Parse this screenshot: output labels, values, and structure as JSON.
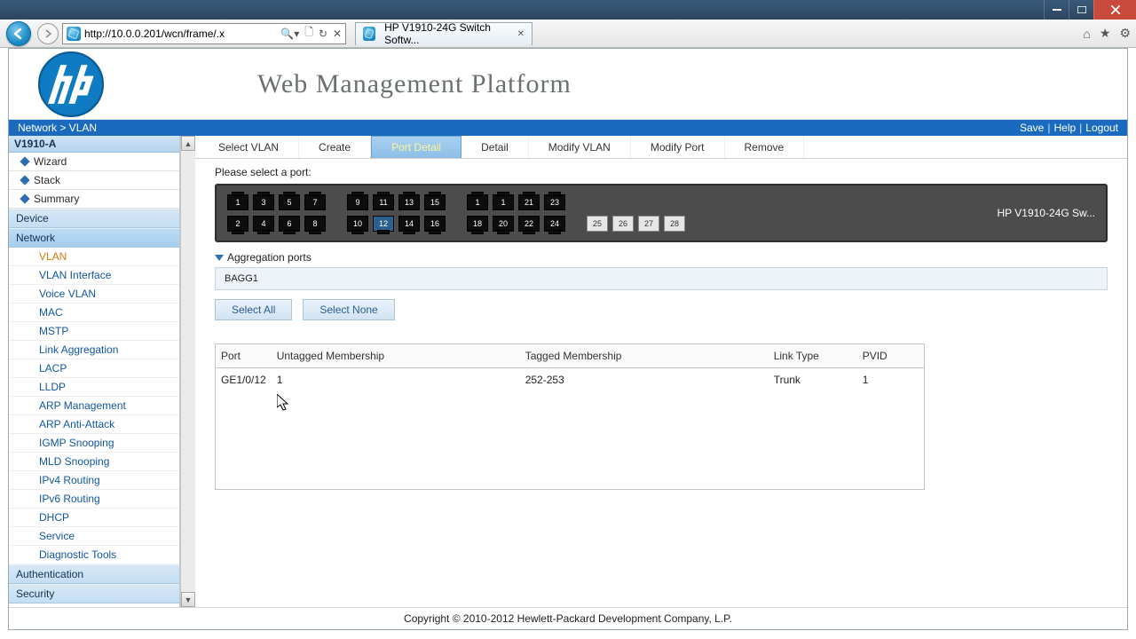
{
  "window": {
    "tab_title": "HP V1910-24G Switch Softw...",
    "url": "http://10.0.0.201/wcn/frame/.x"
  },
  "banner": {
    "title": "Web Management Platform"
  },
  "breadcrumb": "Network > VLAN",
  "toplinks": {
    "save": "Save",
    "help": "Help",
    "logout": "Logout"
  },
  "sidebar": {
    "device_name": "V1910-A",
    "top_items": [
      {
        "label": "Wizard"
      },
      {
        "label": "Stack"
      },
      {
        "label": "Summary"
      }
    ],
    "groups": {
      "device": "Device",
      "network": "Network",
      "authentication": "Authentication",
      "security": "Security"
    },
    "network_items": [
      {
        "label": "VLAN",
        "active": true
      },
      {
        "label": "VLAN Interface"
      },
      {
        "label": "Voice VLAN"
      },
      {
        "label": "MAC"
      },
      {
        "label": "MSTP"
      },
      {
        "label": "Link Aggregation"
      },
      {
        "label": "LACP"
      },
      {
        "label": "LLDP"
      },
      {
        "label": "ARP Management"
      },
      {
        "label": "ARP Anti-Attack"
      },
      {
        "label": "IGMP Snooping"
      },
      {
        "label": "MLD Snooping"
      },
      {
        "label": "IPv4 Routing"
      },
      {
        "label": "IPv6 Routing"
      },
      {
        "label": "DHCP"
      },
      {
        "label": "Service"
      },
      {
        "label": "Diagnostic Tools"
      }
    ]
  },
  "tabs": [
    {
      "label": "Select VLAN"
    },
    {
      "label": "Create"
    },
    {
      "label": "Port Detail",
      "active": true
    },
    {
      "label": "Detail"
    },
    {
      "label": "Modify VLAN"
    },
    {
      "label": "Modify Port"
    },
    {
      "label": "Remove"
    }
  ],
  "prompt": "Please select a port:",
  "switch_label": "HP V1910-24G Sw...",
  "ports": {
    "row1a": [
      "1",
      "3",
      "5",
      "7"
    ],
    "row1b": [
      "9",
      "11",
      "13",
      "15"
    ],
    "row1c": [
      "1",
      "1",
      "21",
      "23"
    ],
    "row2a": [
      "2",
      "4",
      "6",
      "8"
    ],
    "row2b": [
      "10",
      "12",
      "14",
      "16"
    ],
    "row2c": [
      "18",
      "20",
      "22",
      "24"
    ],
    "sfp": [
      "25",
      "26",
      "27",
      "28"
    ],
    "selected": "12"
  },
  "aggregation": {
    "heading": "Aggregation ports",
    "item": "BAGG1"
  },
  "buttons": {
    "select_all": "Select All",
    "select_none": "Select None"
  },
  "table": {
    "headers": {
      "port": "Port",
      "untagged": "Untagged Membership",
      "tagged": "Tagged Membership",
      "linktype": "Link Type",
      "pvid": "PVID"
    },
    "rows": [
      {
        "port": "GE1/0/12",
        "untagged": "1",
        "tagged": "252-253",
        "linktype": "Trunk",
        "pvid": "1"
      }
    ]
  },
  "footer": "Copyright © 2010-2012 Hewlett-Packard Development Company, L.P."
}
